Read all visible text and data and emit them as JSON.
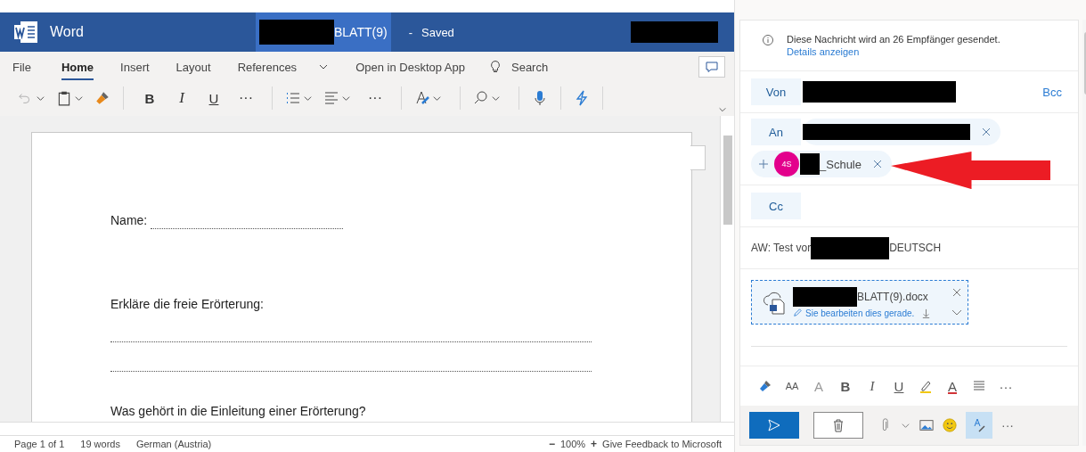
{
  "app": {
    "name": "Word",
    "doc_title": "BLATT(9)",
    "separator": "-",
    "status": "Saved"
  },
  "ribbon_tabs": [
    {
      "label": "File",
      "selected": false
    },
    {
      "label": "Home",
      "selected": true
    },
    {
      "label": "Insert",
      "selected": false
    },
    {
      "label": "Layout",
      "selected": false
    },
    {
      "label": "References",
      "selected": false
    }
  ],
  "ribbon_links": {
    "open_desktop": "Open in Desktop App",
    "search": "Search"
  },
  "toolbar": {
    "bold": "B",
    "italic": "I",
    "underline": "U",
    "more": "···",
    "more_2": "···"
  },
  "document": {
    "lines": [
      {
        "kind": "field",
        "text": "Name:"
      },
      {
        "kind": "text",
        "text": "Erkläre die freie Erörterung:"
      },
      {
        "kind": "blank"
      },
      {
        "kind": "blank"
      },
      {
        "kind": "text",
        "text": "Was gehört in die Einleitung einer Erörterung?"
      }
    ]
  },
  "status_bar": {
    "page": "Page 1 of 1",
    "words": "19 words",
    "language": "German (Austria)",
    "zoom_out": "−",
    "zoom": "100%",
    "zoom_in": "+",
    "feedback": "Give Feedback to Microsoft"
  },
  "mail": {
    "info": {
      "text": "Diese Nachricht wird an 26 Empfänger gesendet.",
      "link": "Details anzeigen"
    },
    "from_label": "Von",
    "bcc": "Bcc",
    "to_label": "An",
    "group": {
      "initials": "4S",
      "name": "_Schule"
    },
    "cc_label": "Cc",
    "subject": {
      "before": "AW: Test vor",
      "after": "DEUTSCH"
    },
    "attachment": {
      "name": "BLATT(9).docx",
      "status": "Sie bearbeiten dies gerade."
    },
    "format": {
      "font_size": "AA",
      "grow": "A",
      "bold": "B",
      "italic": "I",
      "underline": "U",
      "font_color": "A",
      "more": "···"
    },
    "actions_more": "···"
  }
}
